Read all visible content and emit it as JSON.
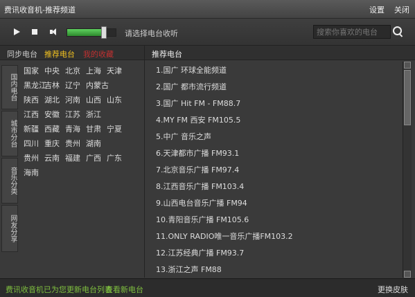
{
  "title": {
    "text": "费讯收音机-推荐频道"
  },
  "titlebar": {
    "settings": "设置",
    "close": "关闭"
  },
  "player": {
    "status": "请选择电台收听",
    "search_placeholder": "搜索你喜欢的电台",
    "volume_level": 0.75
  },
  "left": {
    "tabs": {
      "sync": "同步电台",
      "recommended": "推荐电台",
      "favorites": "我的收藏"
    },
    "categories": [
      "国内电台",
      "城市分台",
      "音乐分类",
      "网友分享"
    ],
    "regions": [
      [
        "国家",
        "中央",
        "北京",
        "上海",
        "天津"
      ],
      [
        "黑龙江",
        "吉林",
        "辽宁",
        "内蒙古"
      ],
      [
        "陕西",
        "湖北",
        "河南",
        "山西",
        "山东"
      ],
      [
        "江西",
        "安徽",
        "江苏",
        "浙江"
      ],
      [
        "新疆",
        "西藏",
        "青海",
        "甘肃",
        "宁夏"
      ],
      [
        "四川",
        "重庆",
        "贵州",
        "湖南"
      ],
      [
        "贵州",
        "云南",
        "福建",
        "广西",
        "广东"
      ],
      [
        "海南"
      ]
    ]
  },
  "right": {
    "title": "推荐电台",
    "stations": [
      "1.国广 环球全能频道",
      "2.国广 都市流行频道",
      "3.国广 Hit FM - FM88.7",
      "4.MY FM 西安 FM105.5",
      "5.中广 音乐之声",
      "6.天津都市广播 FM93.1",
      "7.北京音乐广播 FM97.4",
      "8.江西音乐广播 FM103.4",
      "9.山西电台音乐广播 FM94",
      "10.青阳音乐广播 FM105.6",
      "11.ONLY RADIO唯一音乐广播FM103.2",
      "12.江苏经典广播 FM93.7",
      "13.浙江之声 FM88"
    ]
  },
  "status": {
    "left": "费讯收音机已为您更新电台列表",
    "link": "查看新电台",
    "right": "更换皮肤"
  }
}
